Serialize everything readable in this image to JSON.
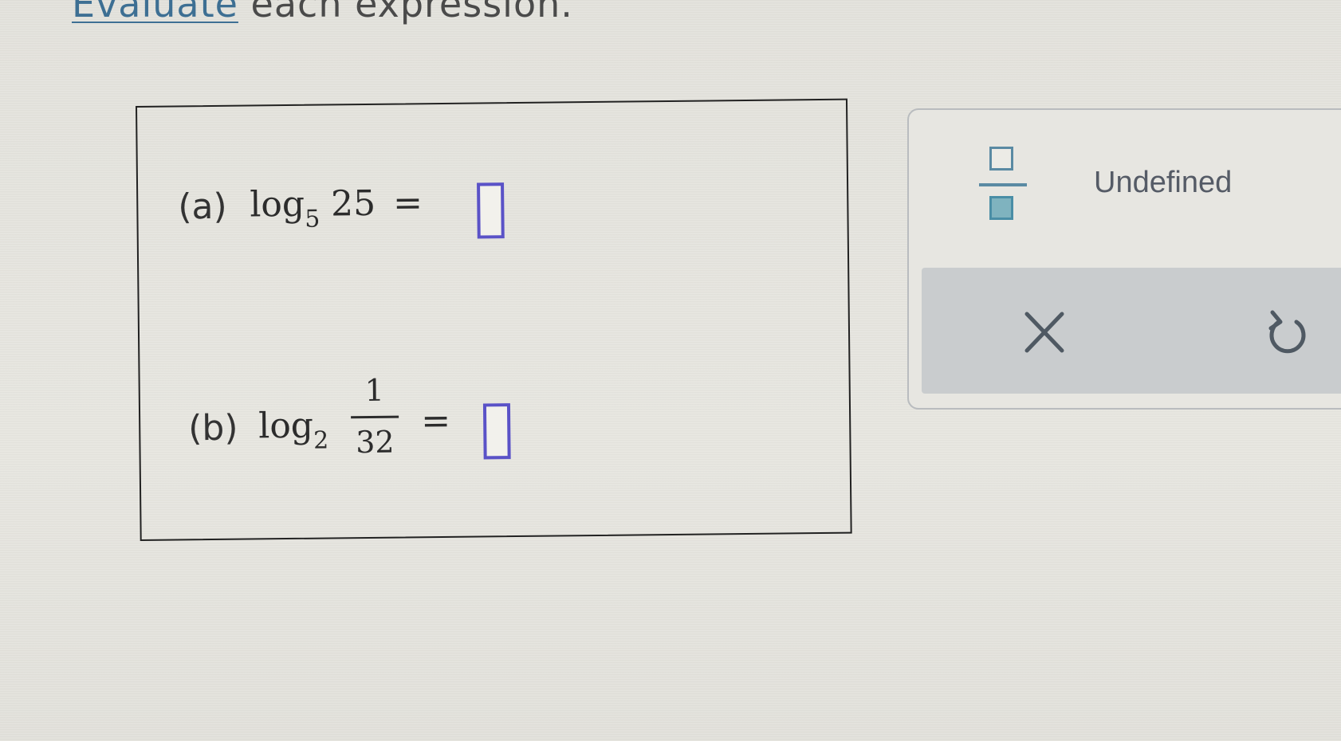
{
  "instruction": {
    "link_text": "Evaluate",
    "rest_text": " each expression."
  },
  "problems": {
    "a": {
      "label": "(a)",
      "func": "log",
      "base": "5",
      "argument": "25",
      "equals": "="
    },
    "b": {
      "label": "(b)",
      "func": "log",
      "base": "2",
      "numerator": "1",
      "denominator": "32",
      "equals": "="
    }
  },
  "palette": {
    "undefined_label": "Undefined",
    "icons": {
      "fraction": "fraction-icon",
      "clear": "close-icon",
      "undo": "undo-icon"
    }
  },
  "colors": {
    "link": "#3d6f93",
    "answer_box_border": "#5a52c7",
    "fraction_icon": "#5a8aa3",
    "action_bar": "#c9ccce"
  }
}
